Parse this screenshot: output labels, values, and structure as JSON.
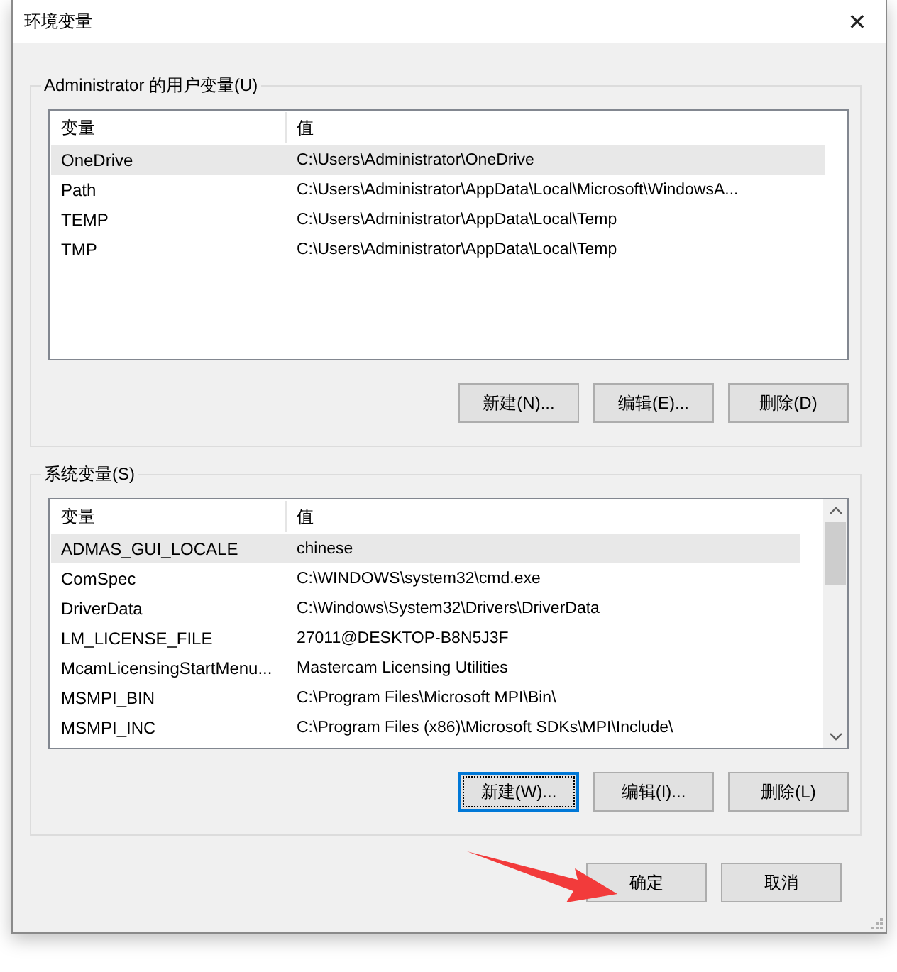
{
  "window": {
    "title": "环境变量",
    "close": "✕"
  },
  "user_vars": {
    "title": "Administrator 的用户变量(U)",
    "columns": [
      "变量",
      "值"
    ],
    "rows": [
      {
        "name": "OneDrive",
        "value": "C:\\Users\\Administrator\\OneDrive",
        "selected": true
      },
      {
        "name": "Path",
        "value": "C:\\Users\\Administrator\\AppData\\Local\\Microsoft\\WindowsA...",
        "selected": false
      },
      {
        "name": "TEMP",
        "value": "C:\\Users\\Administrator\\AppData\\Local\\Temp",
        "selected": false
      },
      {
        "name": "TMP",
        "value": "C:\\Users\\Administrator\\AppData\\Local\\Temp",
        "selected": false
      }
    ],
    "buttons": [
      {
        "label": "新建(N)...",
        "focused": false
      },
      {
        "label": "编辑(E)...",
        "focused": false
      },
      {
        "label": "删除(D)",
        "focused": false
      }
    ]
  },
  "system_vars": {
    "title": "系统变量(S)",
    "columns": [
      "变量",
      "值"
    ],
    "rows": [
      {
        "name": "ADMAS_GUI_LOCALE",
        "value": "chinese",
        "selected": true
      },
      {
        "name": "ComSpec",
        "value": "C:\\WINDOWS\\system32\\cmd.exe",
        "selected": false
      },
      {
        "name": "DriverData",
        "value": "C:\\Windows\\System32\\Drivers\\DriverData",
        "selected": false
      },
      {
        "name": "LM_LICENSE_FILE",
        "value": "27011@DESKTOP-B8N5J3F",
        "selected": false
      },
      {
        "name": "McamLicensingStartMenu...",
        "value": "Mastercam Licensing Utilities",
        "selected": false
      },
      {
        "name": "MSMPI_BIN",
        "value": "C:\\Program Files\\Microsoft MPI\\Bin\\",
        "selected": false
      },
      {
        "name": "MSMPI_INC",
        "value": "C:\\Program Files (x86)\\Microsoft SDKs\\MPI\\Include\\",
        "selected": false
      }
    ],
    "buttons": [
      {
        "label": "新建(W)...",
        "focused": true
      },
      {
        "label": "编辑(I)...",
        "focused": false
      },
      {
        "label": "删除(L)",
        "focused": false
      }
    ]
  },
  "footer_buttons": [
    {
      "label": "确定"
    },
    {
      "label": "取消"
    }
  ]
}
